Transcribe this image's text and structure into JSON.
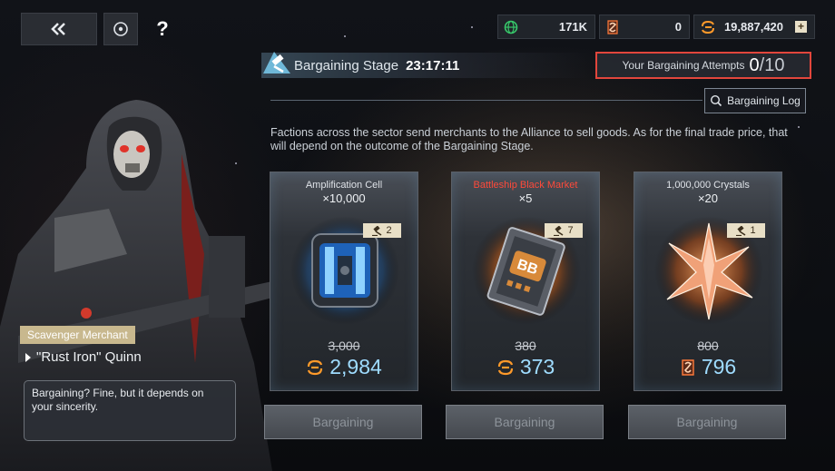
{
  "nav": {
    "back_icon": "double-chevron-left-icon",
    "target_icon": "target-icon",
    "help_label": "?"
  },
  "currencies": [
    {
      "icon": "globe-icon",
      "value": "171K",
      "color": "#37c86a"
    },
    {
      "icon": "bargain-token-icon",
      "value": "0",
      "color": "#ff7a3a"
    },
    {
      "icon": "crystal-coin-icon",
      "value": "19,887,420",
      "color": "#ff9a2a"
    }
  ],
  "header": {
    "stage_label": "Bargaining Stage",
    "stage_timer": "23:17:11",
    "attempts_label": "Your Bargaining Attempts",
    "attempts_used": "0",
    "attempts_max": "/10",
    "log_button": "Bargaining Log"
  },
  "description": "Factions across the sector send merchants to the Alliance to sell goods. As for the final trade price, that will depend on the outcome of the Bargaining Stage.",
  "cards": [
    {
      "title": "Amplification Cell",
      "quantity": "×10,000",
      "bids": "2",
      "old_price": "3,000",
      "new_price": "2,984",
      "currency_icon": "crystal-coin-icon",
      "glow": "#2a7fd0",
      "button": "Bargaining",
      "title_red": false
    },
    {
      "title": "Battleship Black Market",
      "quantity": "×5",
      "bids": "7",
      "old_price": "380",
      "new_price": "373",
      "currency_icon": "crystal-coin-icon",
      "glow": "#e07a1e",
      "button": "Bargaining",
      "title_red": true
    },
    {
      "title": "1,000,000 Crystals",
      "quantity": "×20",
      "bids": "1",
      "old_price": "800",
      "new_price": "796",
      "currency_icon": "bargain-token-icon",
      "glow": "#e07a1e",
      "button": "Bargaining",
      "title_red": false
    }
  ],
  "merchant": {
    "role": "Scavenger Merchant",
    "name": "\"Rust Iron\" Quinn",
    "speech": "Bargaining? Fine, but it depends on your sincerity."
  }
}
